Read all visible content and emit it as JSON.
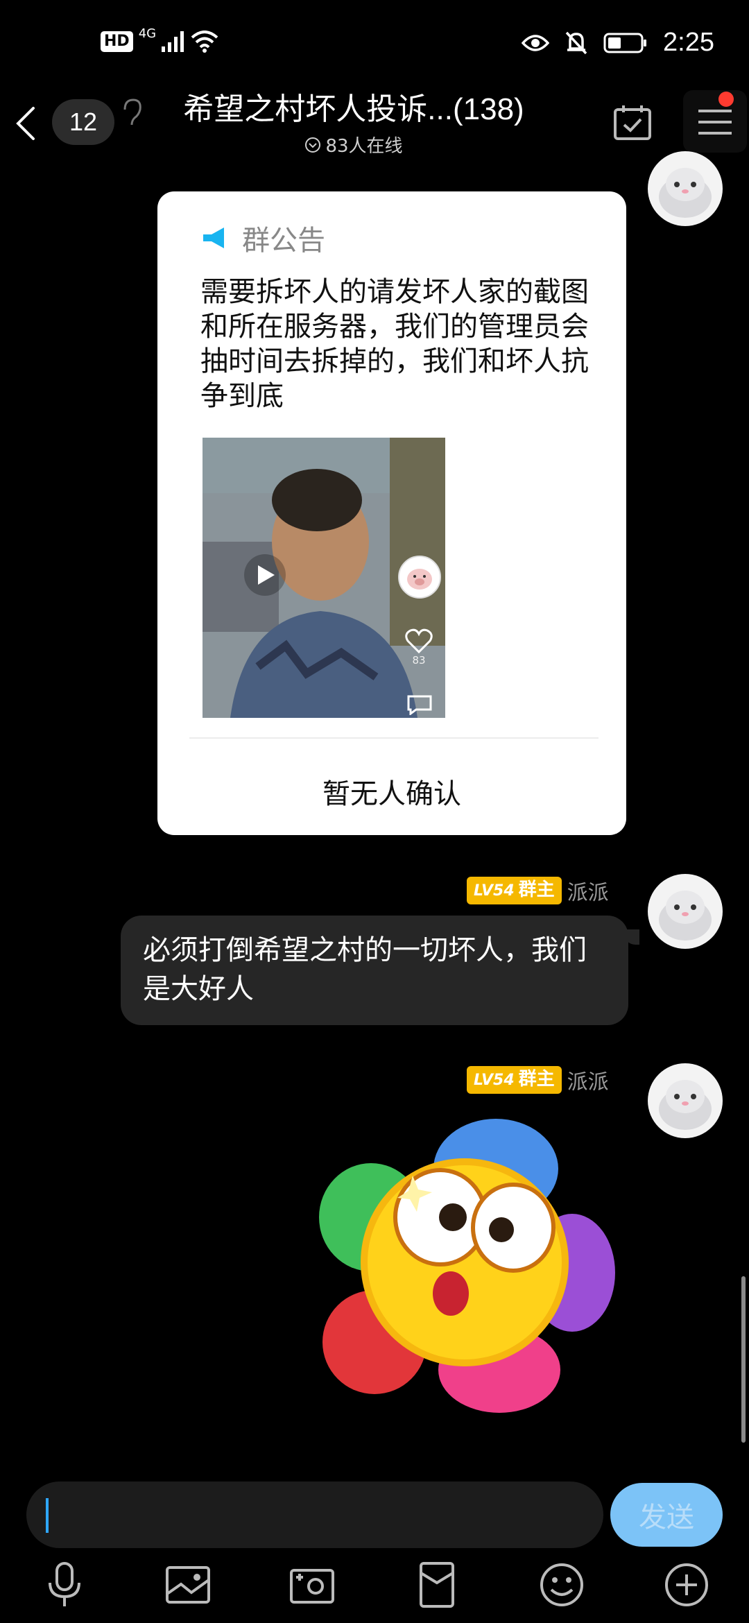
{
  "status_bar": {
    "hd": "HD",
    "network": "4G",
    "time": "2:25"
  },
  "header": {
    "unread_count": "12",
    "title": "希望之村坏人投诉...(138)",
    "online": "83人在线"
  },
  "announcement": {
    "label": "群公告",
    "body": "需要拆坏人的请发坏人家的截图和所在服务器，我们的管理员会抽时间去拆掉的，我们和坏人抗争到底",
    "video_likes": "83",
    "confirm_text": "暂无人确认"
  },
  "messages": [
    {
      "level": "LV54",
      "role": "群主",
      "sender": "派派",
      "text": "必须打倒希望之村的一切坏人，我们是大好人"
    },
    {
      "level": "LV54",
      "role": "群主",
      "sender": "派派",
      "sticker": "flower-emoji-sticker"
    }
  ],
  "input": {
    "placeholder": "",
    "send_label": "发送"
  },
  "toolbar": [
    "microphone-icon",
    "image-icon",
    "camera-icon",
    "red-packet-icon",
    "emoji-icon",
    "plus-icon"
  ],
  "colors": {
    "background": "#000000",
    "accent_blue": "#2ea7ff",
    "send_disabled": "#7cc3f7",
    "level_badge": "#f5b800",
    "notification_red": "#ff3b30"
  }
}
